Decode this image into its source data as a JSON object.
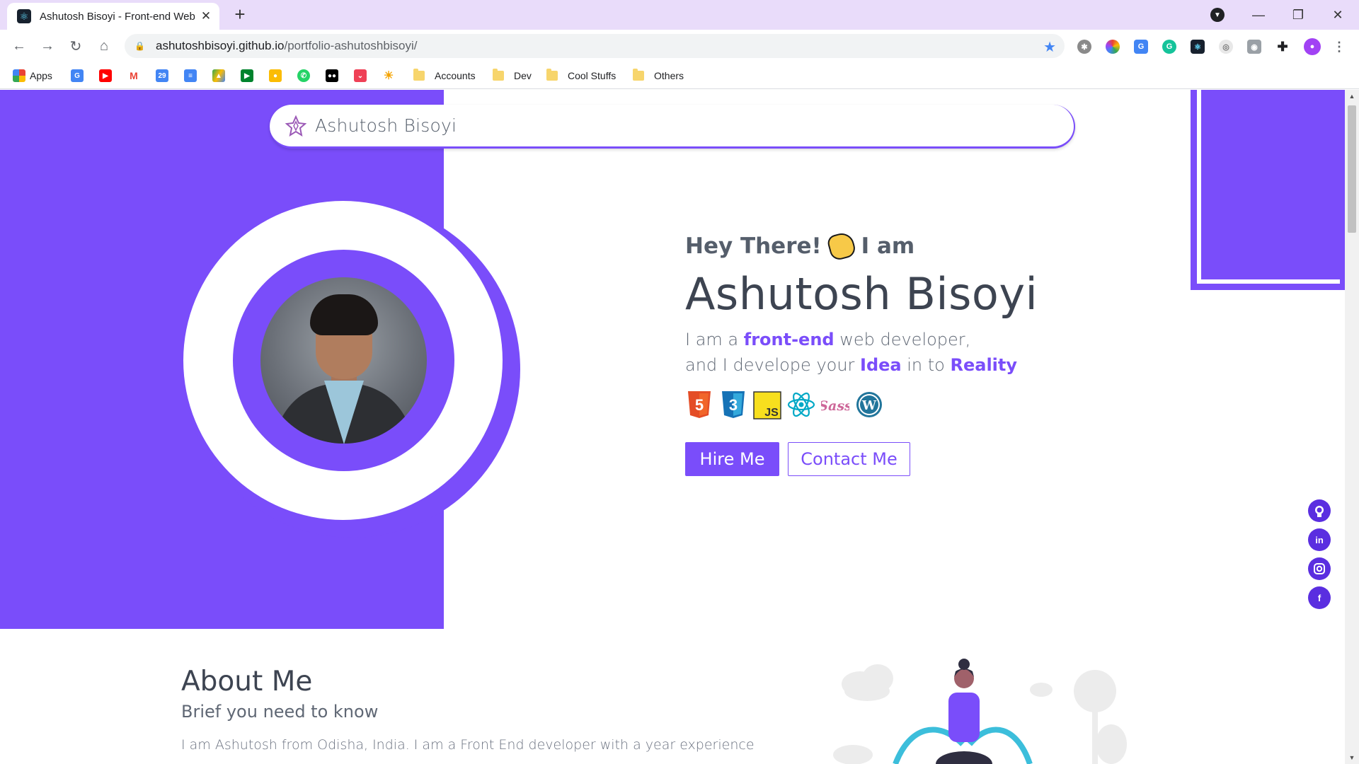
{
  "browser": {
    "tab_title": "Ashutosh Bisoyi - Front-end Web",
    "tab_close": "✕",
    "new_tab": "+",
    "url_host": "ashutoshbisoyi.github.io",
    "url_path": "/portfolio-ashutoshbisoyi/",
    "bookmarks": {
      "apps": "Apps",
      "folders": [
        "Accounts",
        "Dev",
        "Cool Stuffs",
        "Others"
      ]
    }
  },
  "nav": {
    "brand": "Ashutosh Bisoyi"
  },
  "hero": {
    "greeting_start": "Hey There!",
    "greeting_end": "I am",
    "name": "Ashutosh Bisoyi",
    "line1_prefix": "I am a ",
    "line1_highlight": "front-end",
    "line1_suffix": " web developer,",
    "line2_prefix": "and I develope your ",
    "line2_highlight1": "Idea",
    "line2_middle": " in to ",
    "line2_highlight2": "Reality",
    "skills": [
      "html5-icon",
      "css3-icon",
      "javascript-icon",
      "react-icon",
      "sass-icon",
      "wordpress-icon"
    ],
    "hire_button": "Hire Me",
    "contact_button": "Contact Me"
  },
  "about": {
    "title": "About Me",
    "subtitle": "Brief you need to know",
    "body": "I am Ashutosh from Odisha, India. I am a Front End developer with a year experience"
  },
  "socials": [
    "github-icon",
    "linkedin-icon",
    "instagram-icon",
    "facebook-icon"
  ],
  "colors": {
    "accent": "#7a4dfa",
    "text_dark": "#3d4451",
    "text_muted": "#5f6774"
  }
}
